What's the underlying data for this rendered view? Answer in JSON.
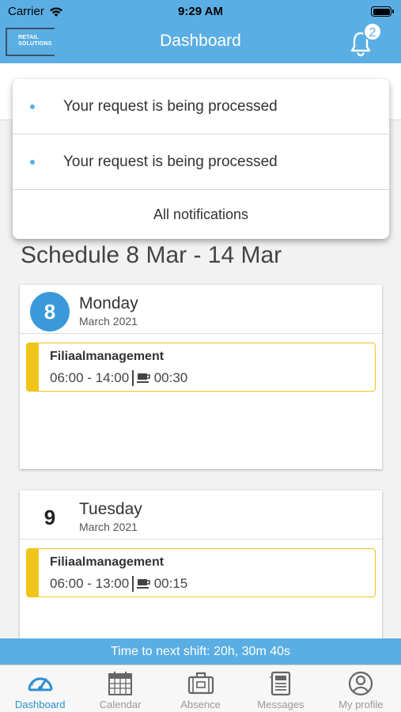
{
  "status_bar": {
    "carrier": "Carrier",
    "time": "9:29 AM"
  },
  "header": {
    "logo_text": "RETAIL\nSOLUTIONS",
    "title": "Dashboard",
    "notification_count": "2"
  },
  "notifications": {
    "items": [
      {
        "text": "Your request is being processed"
      },
      {
        "text": "Your request is being processed"
      }
    ],
    "all_label": "All notifications"
  },
  "schedule": {
    "title": "Schedule 8 Mar - 14 Mar",
    "days": [
      {
        "number": "8",
        "weekday": "Monday",
        "month": "March 2021",
        "shifts": [
          {
            "name": "Filiaalmanagement",
            "time": "06:00 - 14:00",
            "break": "00:30"
          }
        ]
      },
      {
        "number": "9",
        "weekday": "Tuesday",
        "month": "March 2021",
        "shifts": [
          {
            "name": "Filiaalmanagement",
            "time": "06:00 - 13:00",
            "break": "00:15"
          }
        ]
      }
    ]
  },
  "next_shift": "Time to next shift: 20h, 30m 40s",
  "tabs": [
    {
      "label": "Dashboard",
      "icon": "gauge-icon",
      "active": true
    },
    {
      "label": "Calendar",
      "icon": "calendar-icon",
      "active": false
    },
    {
      "label": "Absence",
      "icon": "suitcase-icon",
      "active": false
    },
    {
      "label": "Messages",
      "icon": "newspaper-icon",
      "active": false
    },
    {
      "label": "My profile",
      "icon": "user-icon",
      "active": false
    }
  ],
  "colors": {
    "primary": "#5aaee3",
    "accent": "#3a9ad9",
    "shift": "#f0c419",
    "active_tab": "#2c8fd0"
  }
}
